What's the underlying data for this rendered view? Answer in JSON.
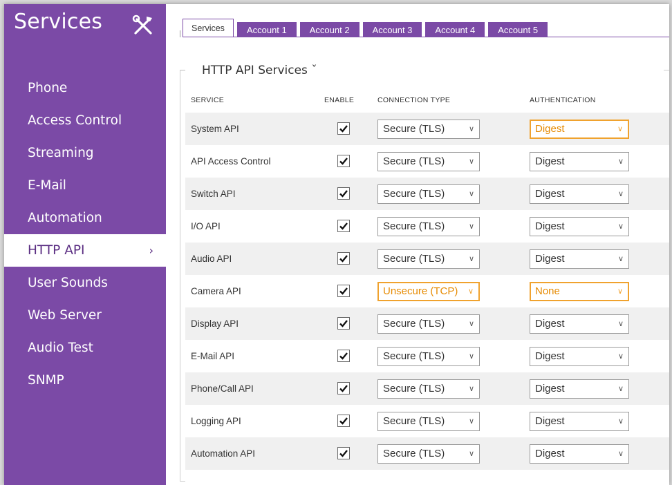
{
  "sidebar": {
    "title": "Services",
    "icon": "tools-icon",
    "items": [
      {
        "label": "Phone"
      },
      {
        "label": "Access Control"
      },
      {
        "label": "Streaming"
      },
      {
        "label": "E-Mail"
      },
      {
        "label": "Automation"
      },
      {
        "label": "HTTP API",
        "chevron": "›",
        "active": true
      },
      {
        "label": "User Sounds"
      },
      {
        "label": "Web Server"
      },
      {
        "label": "Audio Test"
      },
      {
        "label": "SNMP"
      }
    ]
  },
  "tabs": [
    {
      "label": "Services",
      "active": true
    },
    {
      "label": "Account 1"
    },
    {
      "label": "Account 2"
    },
    {
      "label": "Account 3"
    },
    {
      "label": "Account 4"
    },
    {
      "label": "Account 5"
    }
  ],
  "section": {
    "title": "HTTP API Services ˇ"
  },
  "table": {
    "headers": {
      "service": "SERVICE",
      "enable": "ENABLE",
      "connection": "CONNECTION TYPE",
      "auth": "AUTHENTICATION"
    },
    "rows": [
      {
        "service": "System API",
        "enabled": true,
        "connection": "Secure (TLS)",
        "auth": "Digest",
        "auth_warn": true
      },
      {
        "service": "API Access Control",
        "enabled": true,
        "connection": "Secure (TLS)",
        "auth": "Digest"
      },
      {
        "service": "Switch API",
        "enabled": true,
        "connection": "Secure (TLS)",
        "auth": "Digest"
      },
      {
        "service": "I/O API",
        "enabled": true,
        "connection": "Secure (TLS)",
        "auth": "Digest"
      },
      {
        "service": "Audio API",
        "enabled": true,
        "connection": "Secure (TLS)",
        "auth": "Digest"
      },
      {
        "service": "Camera API",
        "enabled": true,
        "connection": "Unsecure (TCP)",
        "conn_warn": true,
        "auth": "None",
        "auth_warn": true
      },
      {
        "service": "Display API",
        "enabled": true,
        "connection": "Secure (TLS)",
        "auth": "Digest"
      },
      {
        "service": "E-Mail API",
        "enabled": true,
        "connection": "Secure (TLS)",
        "auth": "Digest"
      },
      {
        "service": "Phone/Call API",
        "enabled": true,
        "connection": "Secure (TLS)",
        "auth": "Digest"
      },
      {
        "service": "Logging API",
        "enabled": true,
        "connection": "Secure (TLS)",
        "auth": "Digest"
      },
      {
        "service": "Automation API",
        "enabled": true,
        "connection": "Secure (TLS)",
        "auth": "Digest"
      }
    ]
  },
  "colors": {
    "accent": "#7b4aa6",
    "warning": "#f0a22e"
  }
}
